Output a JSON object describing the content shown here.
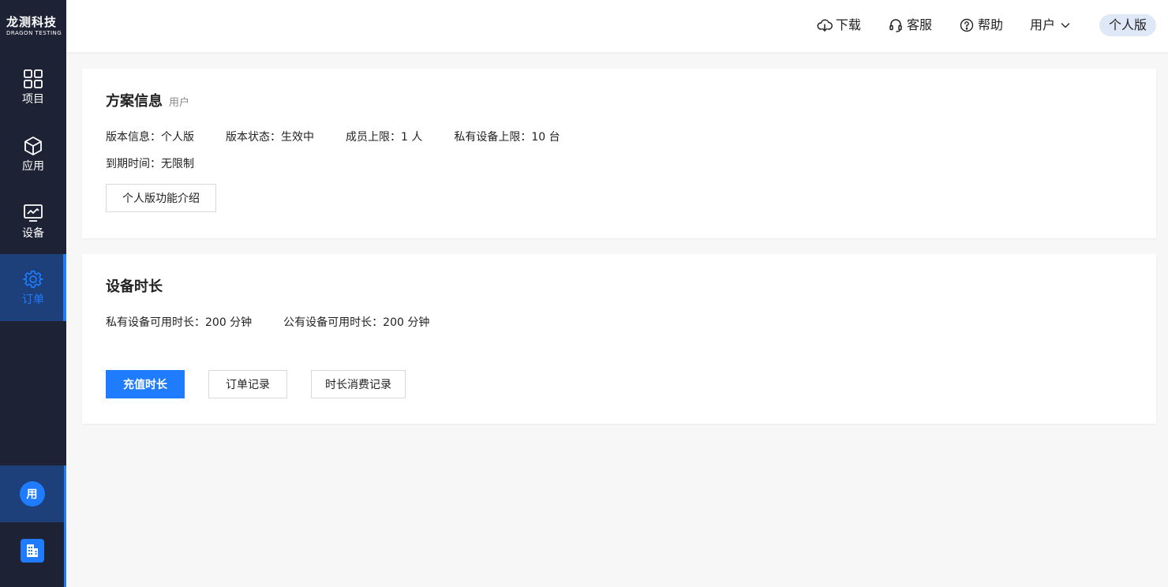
{
  "logo": {
    "name": "龙测科技",
    "sub": "DRAGON TESTING"
  },
  "sidebar": {
    "items": [
      {
        "label": "项目",
        "icon": "grid-icon"
      },
      {
        "label": "应用",
        "icon": "cube-icon"
      },
      {
        "label": "设备",
        "icon": "monitor-icon"
      },
      {
        "label": "订单",
        "icon": "gear-icon",
        "active": true
      }
    ],
    "user_avatar": "用",
    "org_icon": "building-icon"
  },
  "header": {
    "download": "下载",
    "support": "客服",
    "help": "帮助",
    "user": "用户",
    "edition": "个人版"
  },
  "plan": {
    "title": "方案信息",
    "subtitle": "用户",
    "version_info": "版本信息：个人版",
    "version_status": "版本状态：生效中",
    "member_limit": "成员上限：1 人",
    "private_device_limit": "私有设备上限：10 台",
    "expiry": "到期时间：无限制",
    "intro_button": "个人版功能介绍"
  },
  "duration": {
    "title": "设备时长",
    "private_time": "私有设备可用时长：200 分钟",
    "public_time": "公有设备可用时长：200 分钟",
    "recharge_button": "充值时长",
    "orders_button": "订单记录",
    "usage_button": "时长消费记录"
  },
  "colors": {
    "accent": "#1f7cff",
    "sidebar_bg": "#1e2235",
    "active_bg": "#1d3f7a"
  }
}
